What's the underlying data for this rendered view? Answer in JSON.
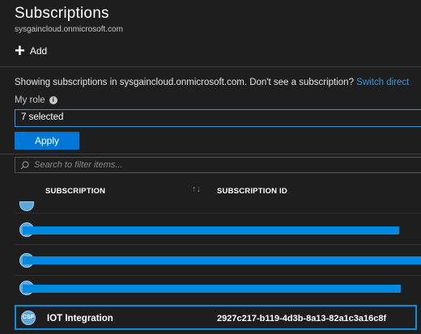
{
  "header": {
    "title": "Subscriptions",
    "subtitle": "sysgaincloud.onmicrosoft.com"
  },
  "toolbar": {
    "add_label": "Add"
  },
  "info": {
    "text": "Showing subscriptions in sysgaincloud.onmicrosoft.com. Don't see a subscription?",
    "link": "Switch direct"
  },
  "role": {
    "label": "My role",
    "selected": "7 selected"
  },
  "apply_label": "Apply",
  "filter": {
    "placeholder": "Search to filter items..."
  },
  "columns": {
    "subscription": "SUBSCRIPTION",
    "subscription_id": "SUBSCRIPTION ID"
  },
  "rows": [
    {
      "icon": ""
    },
    {
      "icon": ""
    },
    {
      "icon": "CS"
    },
    {
      "icon": "CS"
    },
    {
      "icon": "CSP",
      "name": "IOT Integration",
      "id": "2927c217-b119-4d3b-8a13-82a1c3a16c8f"
    }
  ],
  "colors": {
    "background": "#1e1e1e",
    "accent": "#0078d7",
    "link": "#3a96dd",
    "redaction": "#0089e0"
  }
}
